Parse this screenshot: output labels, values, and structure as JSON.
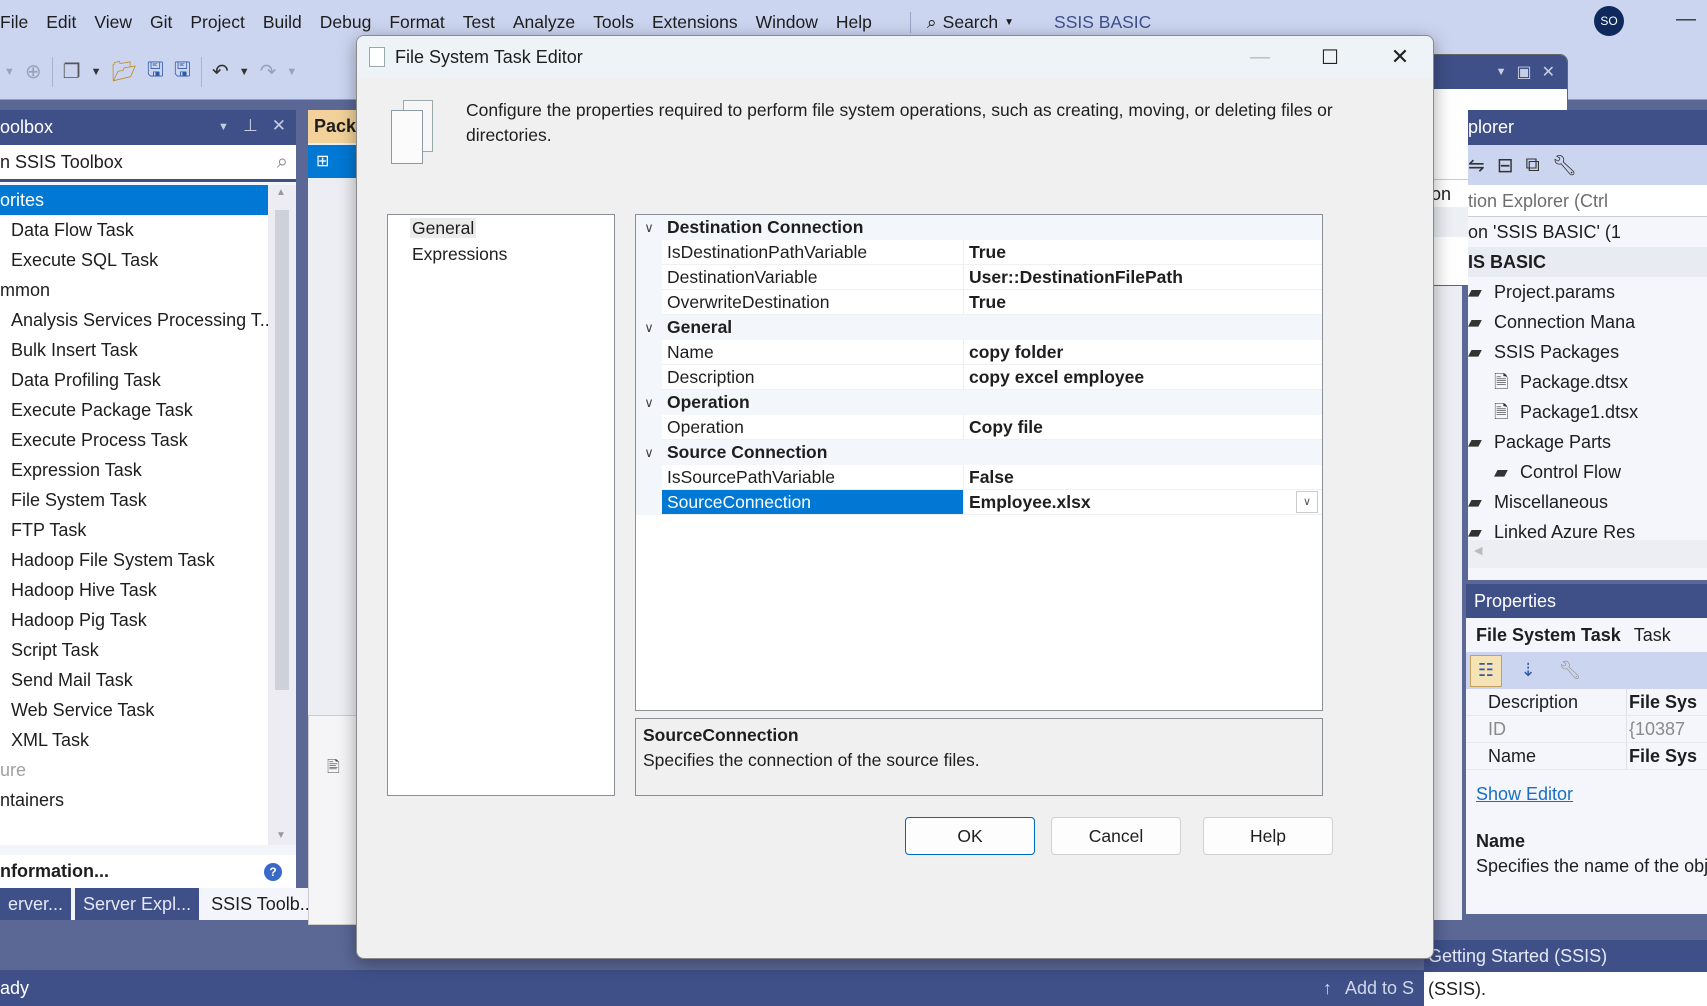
{
  "menubar": {
    "items": [
      "File",
      "Edit",
      "View",
      "Git",
      "Project",
      "Build",
      "Debug",
      "Format",
      "Test",
      "Analyze",
      "Tools",
      "Extensions",
      "Window",
      "Help"
    ],
    "search_label": "Search",
    "app_title": "SSIS BASIC",
    "avatar_initials": "SO"
  },
  "toolbox": {
    "title": "oolbox",
    "search_placeholder": "n SSIS Toolbox",
    "rows": [
      {
        "label": "orites",
        "kind": "category-selected"
      },
      {
        "label": "Data Flow Task",
        "kind": "item"
      },
      {
        "label": "Execute SQL Task",
        "kind": "item"
      },
      {
        "label": "mmon",
        "kind": "category"
      },
      {
        "label": "Analysis Services Processing T...",
        "kind": "item"
      },
      {
        "label": "Bulk Insert Task",
        "kind": "item"
      },
      {
        "label": "Data Profiling Task",
        "kind": "item"
      },
      {
        "label": "Execute Package Task",
        "kind": "item"
      },
      {
        "label": "Execute Process Task",
        "kind": "item"
      },
      {
        "label": "Expression Task",
        "kind": "item"
      },
      {
        "label": "File System Task",
        "kind": "item"
      },
      {
        "label": "FTP Task",
        "kind": "item"
      },
      {
        "label": "Hadoop File System Task",
        "kind": "item"
      },
      {
        "label": "Hadoop Hive Task",
        "kind": "item"
      },
      {
        "label": "Hadoop Pig Task",
        "kind": "item"
      },
      {
        "label": "Script Task",
        "kind": "item"
      },
      {
        "label": "Send Mail Task",
        "kind": "item"
      },
      {
        "label": "Web Service Task",
        "kind": "item"
      },
      {
        "label": "XML Task",
        "kind": "item"
      },
      {
        "label": "ure",
        "kind": "category-dim"
      },
      {
        "label": "ntainers",
        "kind": "category"
      }
    ],
    "info_label": "nformation...",
    "bottom_tabs": [
      "erver...",
      "Server Expl...",
      "SSIS Toolb..."
    ]
  },
  "designer": {
    "tab_label": "Pack"
  },
  "float_window": {
    "column_text": "on",
    "ellipsis": "..."
  },
  "solution_explorer": {
    "title": "plorer",
    "search_placeholder": "tion Explorer (Ctrl",
    "solution_label": "on 'SSIS BASIC' (1",
    "project_label": "IS BASIC",
    "items": [
      {
        "label": "Project.params",
        "level": 1,
        "expander": false
      },
      {
        "label": "Connection Mana",
        "level": 1,
        "expander": false
      },
      {
        "label": "SSIS Packages",
        "level": 1,
        "expander": true
      },
      {
        "label": "Package.dtsx",
        "level": 2,
        "expander": false
      },
      {
        "label": "Package1.dtsx",
        "level": 2,
        "expander": false
      },
      {
        "label": "Package Parts",
        "level": 1,
        "expander": true
      },
      {
        "label": "Control Flow",
        "level": 2,
        "expander": false
      },
      {
        "label": "Miscellaneous",
        "level": 1,
        "expander": false
      },
      {
        "label": "Linked Azure Res",
        "level": 1,
        "expander": true
      }
    ]
  },
  "properties": {
    "title": "Properties",
    "object_name": "File System Task",
    "object_type": "Task",
    "rows": [
      {
        "key": "Description",
        "value": "File Sys",
        "dim": false
      },
      {
        "key": "ID",
        "value": "{10387",
        "dim": true
      },
      {
        "key": "Name",
        "value": "File Sys",
        "dim": false
      }
    ],
    "show_editor_link": "Show Editor",
    "desc_title": "Name",
    "desc_text": "Specifies the name of the obj"
  },
  "status_bar": {
    "text": "ady",
    "add_to_source": "Add to S"
  },
  "getting_started": {
    "title": "Getting Started (SSIS)",
    "body": "(SSIS)."
  },
  "dialog": {
    "title": "File System Task Editor",
    "description": "Configure the properties required to perform file system operations, such as creating, moving, or deleting files or directories.",
    "nav_items": [
      {
        "label": "General",
        "selected": true
      },
      {
        "label": "Expressions",
        "selected": false
      }
    ],
    "categories": [
      {
        "name": "Destination Connection",
        "props": [
          {
            "key": "IsDestinationPathVariable",
            "value": "True"
          },
          {
            "key": "DestinationVariable",
            "value": "User::DestinationFilePath"
          },
          {
            "key": "OverwriteDestination",
            "value": "True"
          }
        ]
      },
      {
        "name": "General",
        "props": [
          {
            "key": "Name",
            "value": "copy folder"
          },
          {
            "key": "Description",
            "value": "copy excel employee"
          }
        ]
      },
      {
        "name": "Operation",
        "props": [
          {
            "key": "Operation",
            "value": "Copy file"
          }
        ]
      },
      {
        "name": "Source Connection",
        "props": [
          {
            "key": "IsSourcePathVariable",
            "value": "False"
          },
          {
            "key": "SourceConnection",
            "value": "Employee.xlsx",
            "selected": true
          }
        ]
      }
    ],
    "help_title": "SourceConnection",
    "help_text": "Specifies the connection of the source files.",
    "buttons": {
      "ok": "OK",
      "cancel": "Cancel",
      "help": "Help"
    }
  }
}
